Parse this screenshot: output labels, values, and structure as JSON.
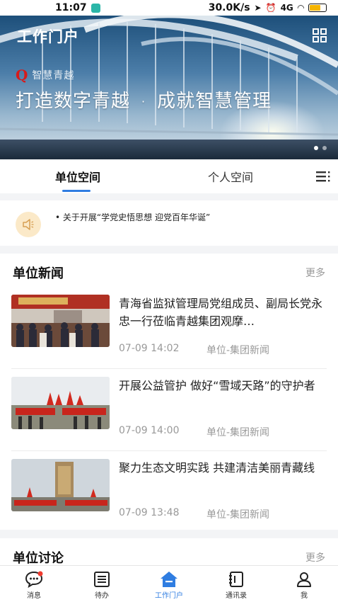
{
  "status_bar": {
    "time": "11:07",
    "network_speed": "30.0K/s",
    "signal_label": "4G"
  },
  "banner": {
    "page_title": "工作门户",
    "logo_text": "智慧青越",
    "slogan_left": "打造数字青越",
    "slogan_sep": "·",
    "slogan_right": "成就智慧管理"
  },
  "tabs": {
    "unit_space": "单位空间",
    "personal_space": "个人空间"
  },
  "notice": {
    "text": "关于开展“学党史悟思想 迎党百年华诞”"
  },
  "news_section": {
    "title": "单位新闻",
    "more": "更多",
    "items": [
      {
        "title": "青海省监狱管理局党组成员、副局长党永忠一行莅临青越集团观摩…",
        "time": "07-09 14:02",
        "category": "单位-集团新闻"
      },
      {
        "title": "开展公益管护 做好“雪域天路”的守护者",
        "time": "07-09 14:00",
        "category": "单位-集团新闻"
      },
      {
        "title": "聚力生态文明实践 共建清洁美丽青藏线",
        "time": "07-09 13:48",
        "category": "单位-集团新闻"
      }
    ]
  },
  "discussion_section": {
    "title": "单位讨论",
    "more": "更多"
  },
  "bottom_nav": {
    "messages": "消息",
    "todo": "待办",
    "portal": "工作门户",
    "contacts": "通讯录",
    "me": "我"
  },
  "colors": {
    "accent": "#2f7de1",
    "muted_text": "#999999"
  }
}
